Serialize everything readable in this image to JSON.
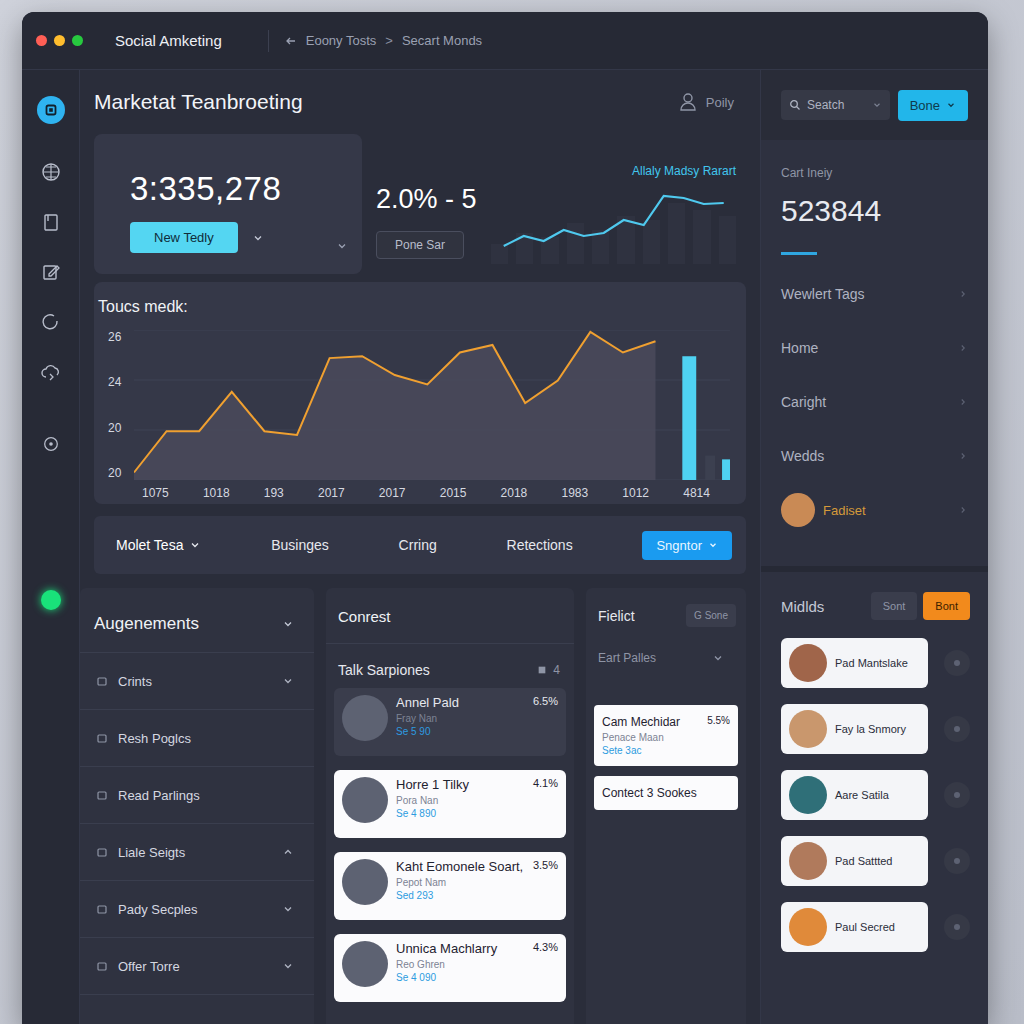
{
  "window": {
    "title": "Social Amketing",
    "breadcrumb": {
      "items": [
        "Eoony Tosts",
        "Secart Monds"
      ],
      "separator": ">"
    }
  },
  "sidebar": {
    "items": [
      {
        "selected": true
      },
      {
        "selected": false
      },
      {
        "selected": false
      },
      {
        "selected": false
      },
      {
        "selected": false
      },
      {
        "selected": false
      },
      {
        "selected": false
      }
    ],
    "status": {
      "on": true
    }
  },
  "header": {
    "title": "Marketat Teanbroeting",
    "user": "Poily"
  },
  "stat_total": {
    "value": "3:335,278",
    "button": "New Tedly"
  },
  "stat_rate": {
    "value": "2.0% - 5",
    "button": "Pone Sar",
    "chart_title": "Allaly Madsy Rarart",
    "values": [
      2,
      3,
      2.5,
      3.6,
      3,
      3.3,
      4.6,
      4.1,
      7,
      6.8,
      6.2,
      6.3
    ],
    "bar_levels": [
      0.3,
      0.45,
      0.4,
      0.6,
      0.5,
      0.7,
      0.65,
      0.9,
      0.8,
      0.7
    ]
  },
  "main_chart": {
    "title": "Toucs medk:",
    "y_ticks": [
      "26",
      "24",
      "20",
      "20"
    ],
    "x_labels": [
      "1075",
      "1018",
      "193",
      "2017",
      "2017",
      "2015",
      "2018",
      "1983",
      "1012",
      "4814"
    ],
    "series": [
      {
        "name": "line",
        "color": "#f0a030",
        "values": [
          18.4,
          20.6,
          20.6,
          22.7,
          20.6,
          20.4,
          24.5,
          24.6,
          23.6,
          23.1,
          24.8,
          25.2,
          22.1,
          23.3,
          25.9,
          24.8,
          25.4
        ]
      }
    ],
    "bars": [
      {
        "value": 24.6,
        "color": "#4fd2f2"
      },
      {
        "value": 19.3,
        "color": "#3c4050"
      },
      {
        "value": 19.1,
        "color": "#4fd2f2"
      }
    ]
  },
  "tabs": {
    "items": [
      {
        "label": "Molet Tesa",
        "selected": true,
        "dropdown": true
      },
      {
        "label": "Businges",
        "selected": false,
        "dropdown": false
      },
      {
        "label": "Crring",
        "selected": false,
        "dropdown": false
      },
      {
        "label": "Retections",
        "selected": false,
        "dropdown": false
      }
    ],
    "button": "Sngntor"
  },
  "augenements": {
    "title": "Augenements",
    "items": [
      {
        "label": "Crints",
        "kind": "group",
        "expanded": false
      },
      {
        "label": "Resh Poglcs",
        "kind": "leaf",
        "expanded": false
      },
      {
        "label": "Read Parlings",
        "kind": "leaf",
        "expanded": false
      },
      {
        "label": "Liale Seigts",
        "kind": "group",
        "expanded": true
      },
      {
        "label": "Pady Secples",
        "kind": "group",
        "expanded": false
      },
      {
        "label": "Offer Torre",
        "kind": "group",
        "expanded": false
      }
    ]
  },
  "conrest": {
    "title": "Conrest",
    "subtitle": "Talk Sarpiones",
    "count": "4",
    "cards": [
      {
        "name": "Annel Pald",
        "role": "Fray Nan",
        "meta": "Se 5 90",
        "percent": "6.5%",
        "kind": "muted"
      },
      {
        "name": "Horre 1 Tilky",
        "role": "Pora Nan",
        "meta": "Se 4 890",
        "percent": "4.1%",
        "kind": "card"
      },
      {
        "name": "Kaht Eomonele Soart,",
        "role": "Pepot Nam",
        "meta": "Sed 293",
        "percent": "3.5%",
        "kind": "card"
      },
      {
        "name": "Unnica Machlarry",
        "role": "Reo Ghren",
        "meta": "Se 4 090",
        "percent": "4.3%",
        "kind": "card"
      }
    ]
  },
  "fielict": {
    "title": "Fielict",
    "button": "G Sone",
    "dropdown": "Eart Palles",
    "cards": [
      {
        "name": "Cam Mechidar",
        "role": "Penace Maan",
        "meta": "Sete 3ac",
        "percent": "5.5%"
      },
      {
        "name": "Contect 3 Sookes",
        "role": "",
        "meta": "",
        "percent": ""
      }
    ]
  },
  "right_top": {
    "search": {
      "placeholder": "Seatch"
    },
    "button": "Bone"
  },
  "right_panel": {
    "label": "Cart Ineiy",
    "value": "523844",
    "items": [
      "Wewlert Tags",
      "Home",
      "Caright",
      "Wedds"
    ],
    "profile": {
      "name": "Fadiset",
      "color": "#c98a55"
    }
  },
  "midlds": {
    "title": "Midlds",
    "buttons": [
      {
        "label": "Sont",
        "selected": false
      },
      {
        "label": "Bont",
        "selected": true
      }
    ],
    "people": [
      {
        "name": "Pad Mantslake",
        "color": "#a0654a"
      },
      {
        "name": "Fay la Snmory",
        "color": "#c9976d"
      },
      {
        "name": "Aare Satila",
        "color": "#2f6f78"
      },
      {
        "name": "Pad Sattted",
        "color": "#b07a5c"
      },
      {
        "name": "Paul Secred",
        "color": "#e08a3a"
      }
    ]
  }
}
